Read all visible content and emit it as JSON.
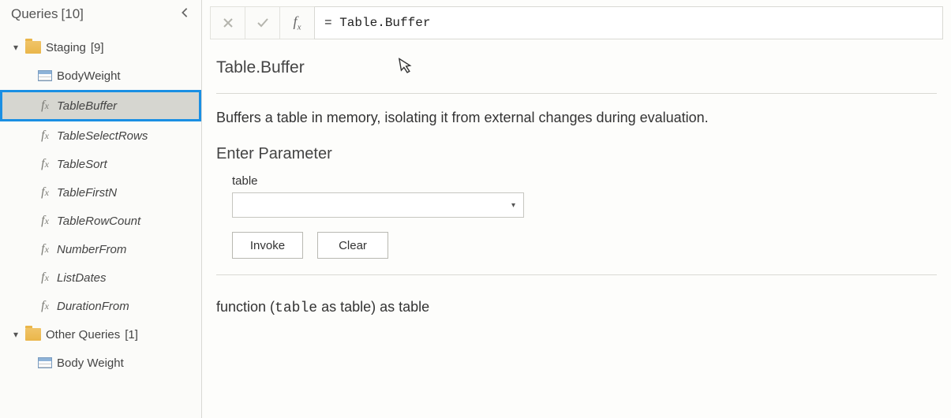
{
  "queries": {
    "header": {
      "title": "Queries",
      "count": "[10]"
    },
    "groups": [
      {
        "label": "Staging",
        "count": "[9]",
        "items": [
          {
            "label": "BodyWeight",
            "kind": "table",
            "italic": false,
            "selected": false
          },
          {
            "label": "TableBuffer",
            "kind": "fx",
            "italic": true,
            "selected": true
          },
          {
            "label": "TableSelectRows",
            "kind": "fx",
            "italic": true,
            "selected": false
          },
          {
            "label": "TableSort",
            "kind": "fx",
            "italic": true,
            "selected": false
          },
          {
            "label": "TableFirstN",
            "kind": "fx",
            "italic": true,
            "selected": false
          },
          {
            "label": "TableRowCount",
            "kind": "fx",
            "italic": true,
            "selected": false
          },
          {
            "label": "NumberFrom",
            "kind": "fx",
            "italic": true,
            "selected": false
          },
          {
            "label": "ListDates",
            "kind": "fx",
            "italic": true,
            "selected": false
          },
          {
            "label": "DurationFrom",
            "kind": "fx",
            "italic": true,
            "selected": false
          }
        ]
      },
      {
        "label": "Other Queries",
        "count": "[1]",
        "items": [
          {
            "label": "Body Weight",
            "kind": "table",
            "italic": false,
            "selected": false
          }
        ]
      }
    ]
  },
  "formula_bar": {
    "value": "= Table.Buffer"
  },
  "main": {
    "function_name": "Table.Buffer",
    "description": "Buffers a table in memory, isolating it from external changes during evaluation.",
    "enter_parameter_heading": "Enter Parameter",
    "param_label": "table",
    "buttons": {
      "invoke": "Invoke",
      "clear": "Clear"
    },
    "signature": {
      "prefix": "function (",
      "arg_name": "table",
      "arg_mid": " as table) as table"
    }
  }
}
